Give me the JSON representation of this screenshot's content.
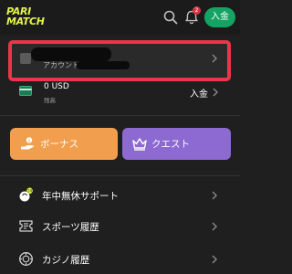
{
  "header": {
    "logo_line1": "PARI",
    "logo_line2": "MATCH",
    "notification_count": "2",
    "deposit_label": "入金"
  },
  "account": {
    "label": "アカウント"
  },
  "balance": {
    "amount": "0 USD",
    "sub_label": "残高",
    "deposit_label": "入金"
  },
  "actions": {
    "bonus_label": "ボーナス",
    "quest_label": "クエスト"
  },
  "menu": [
    {
      "label": "年中無休サポート",
      "icon": "support-icon"
    },
    {
      "label": "スポーツ履歴",
      "icon": "ticket-icon"
    },
    {
      "label": "カジノ履歴",
      "icon": "casino-chip-icon"
    }
  ],
  "colors": {
    "background": "#1f1f1f",
    "logo": "#e4f34a",
    "deposit_button": "#15a364",
    "highlight": "#e8364a",
    "bonus": "#f19e4e",
    "quest": "#8d6ad2",
    "badge": "#e0313f"
  }
}
